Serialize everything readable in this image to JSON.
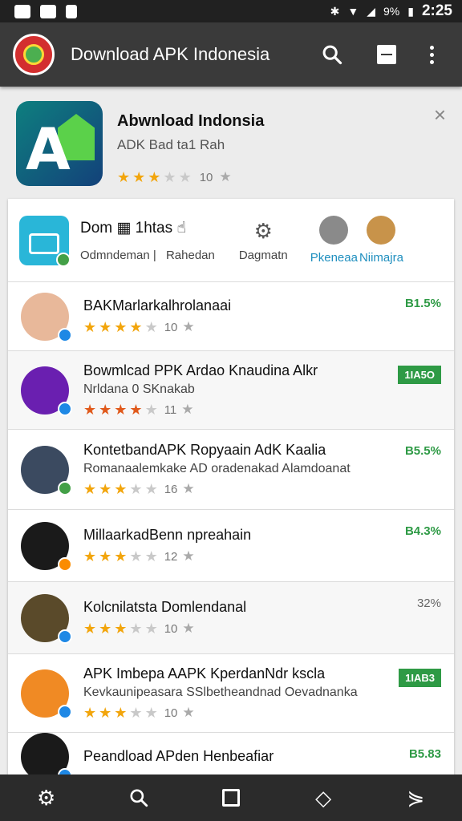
{
  "status_bar": {
    "time": "2:25",
    "battery": "9%"
  },
  "app_bar": {
    "title": "Download APK Indonesia",
    "icons": [
      "app-logo",
      "search-icon",
      "square-icon",
      "more-vert-icon"
    ]
  },
  "featured": {
    "title": "Abwnload Indonsia",
    "subtitle": "ADK Bad ta1 Rah",
    "stars": 3,
    "rating": "10",
    "close_label": "×"
  },
  "categories": {
    "title": "Dom",
    "title_suffix": "1htas",
    "items": [
      "Odmndeman",
      "Rahedan",
      "Dagmatn",
      "Pkeneaa",
      "Niimajra"
    ]
  },
  "apps": [
    {
      "title": "BAKMarlarkalhrolanaai",
      "subtitle": "",
      "stars": 4,
      "rating": "10",
      "badge": "B1.5%",
      "badge_style": "text",
      "avatar_color": "#e8b89a",
      "badge_color": "blue"
    },
    {
      "title": "Bowmlcad PPK Ardao Knaudina Alkr",
      "subtitle": "Nrldana 0 SKnakab",
      "stars": 4,
      "rating": "11",
      "badge": "1IA5O",
      "badge_style": "box",
      "avatar_color": "#6a1fb0",
      "badge_color": "blue",
      "star_style": "red"
    },
    {
      "title": "KontetbandAPK Ropyaain AdK Kaalia",
      "subtitle": "Romanaalemkake AD oradenakad Alamdoanat",
      "stars": 3,
      "rating": "16",
      "badge": "B5.5%",
      "badge_style": "text",
      "avatar_color": "#3b4a60",
      "badge_color": "green"
    },
    {
      "title": "MillaarkadBenn npreahain",
      "subtitle": "",
      "stars": 3,
      "rating": "12",
      "badge": "B4.3%",
      "badge_style": "text",
      "avatar_color": "#1a1a1a",
      "badge_color": "orange"
    },
    {
      "title": "Kolcnilatsta Domlendanal",
      "subtitle": "",
      "stars": 3,
      "rating": "10",
      "badge": "32%",
      "badge_style": "gray",
      "avatar_color": "#5a4a2a",
      "badge_color": "blue"
    },
    {
      "title": "APK Imbepa AAPK KperdanNdr kscla",
      "subtitle": "Kevkaunipeasara SSlbetheandnad Oevadnanka",
      "stars": 3,
      "rating": "10",
      "badge": "1IAB3",
      "badge_style": "box",
      "avatar_color": "#f08a24",
      "badge_color": "blue"
    },
    {
      "title": "Peandload APden Henbeafiar",
      "subtitle": "",
      "stars": 0,
      "rating": "",
      "badge": "B5.83",
      "badge_style": "text",
      "avatar_color": "#1a1a1a",
      "badge_color": "blue"
    }
  ],
  "bottom_nav": [
    "apps-icon",
    "search-icon",
    "home-icon",
    "tag-icon",
    "share-icon"
  ]
}
